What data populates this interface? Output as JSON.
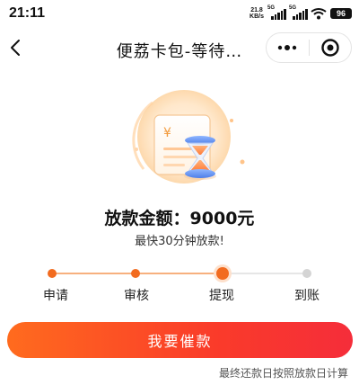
{
  "status_bar": {
    "time": "21:11",
    "net_speed_value": "21.8",
    "net_speed_unit": "KB/s",
    "signal_1_tech": "5G",
    "signal_2_tech": "5G",
    "battery": "96"
  },
  "nav": {
    "title": "便荔卡包-等待…"
  },
  "illustration": {
    "currency_symbol": "¥"
  },
  "loan": {
    "amount_title": "放款金额：9000元",
    "eta": "最快30分钟放款!"
  },
  "progress": {
    "steps": [
      {
        "label": "申请",
        "state": "done"
      },
      {
        "label": "审核",
        "state": "done"
      },
      {
        "label": "提现",
        "state": "current"
      },
      {
        "label": "到账",
        "state": "pending"
      }
    ]
  },
  "actions": {
    "urge_label": "我要催款"
  },
  "footnote": "最终还款日按照放款日计算",
  "colors": {
    "accent": "#f26b1f",
    "button_start": "#ff6b1e",
    "button_end": "#f52d3a",
    "pending": "#d4d4d4"
  }
}
